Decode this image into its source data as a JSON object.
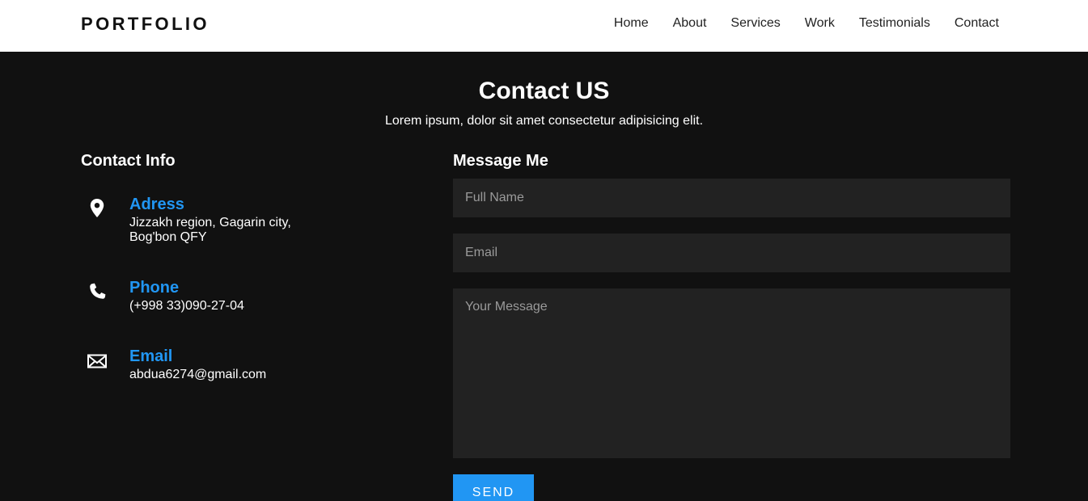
{
  "header": {
    "logo": "PORTFOLIO",
    "nav": [
      "Home",
      "About",
      "Services",
      "Work",
      "Testimonials",
      "Contact"
    ]
  },
  "contact": {
    "title": "Contact US",
    "subtitle": "Lorem ipsum, dolor sit amet consectetur adipisicing elit.",
    "info_title": "Contact Info",
    "items": [
      {
        "icon": "location-pin-icon",
        "label": "Adress",
        "lines": [
          "Jizzakh region, Gagarin city,",
          "Bog'bon QFY"
        ]
      },
      {
        "icon": "phone-icon",
        "label": "Phone",
        "lines": [
          "(+998 33)090-27-04"
        ]
      },
      {
        "icon": "envelope-icon",
        "label": "Email",
        "lines": [
          "abdua6274@gmail.com"
        ]
      }
    ],
    "form": {
      "title": "Message Me",
      "name_placeholder": "Full Name",
      "email_placeholder": "Email",
      "message_placeholder": "Your Message",
      "send_label": "SEND"
    }
  },
  "colors": {
    "accent": "#2196f3",
    "background": "#111111",
    "field": "#222222",
    "header": "#ffffff"
  }
}
